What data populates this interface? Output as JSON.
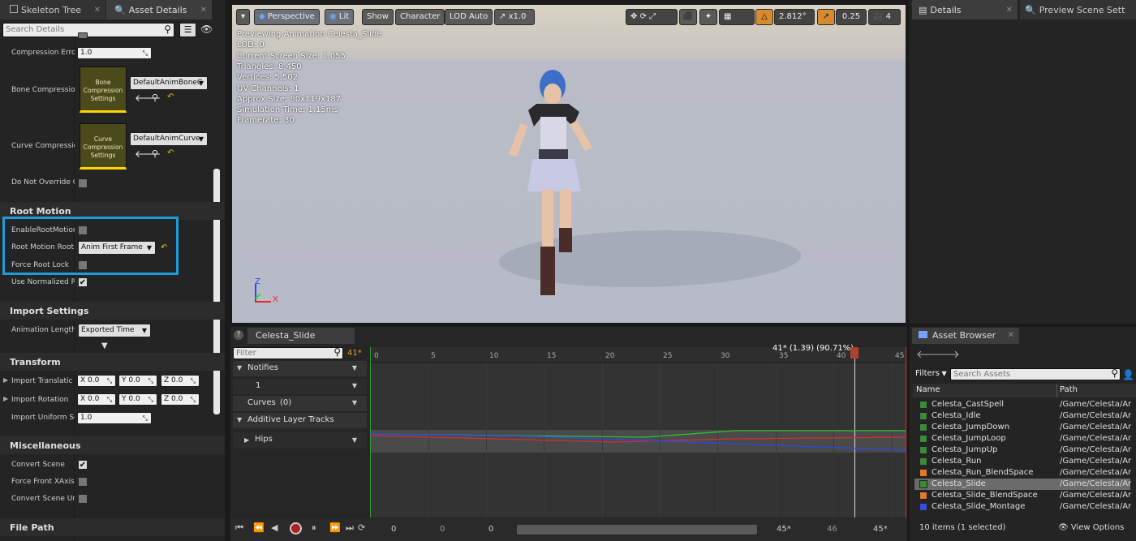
{
  "left_panel": {
    "tabs": [
      "Skeleton Tree",
      "Asset Details"
    ],
    "search_placeholder": "Search Details",
    "rows": {
      "compression_error_label": "Compression Erro",
      "compression_error_value": "1.0",
      "bone_compression_label": "Bone Compressio",
      "bone_thumb": "Bone Compression Settings",
      "bone_combo": "DefaultAnimBoneC",
      "curve_compression_label": "Curve Compressio",
      "curve_thumb": "Curve Compression Settings",
      "curve_combo": "DefaultAnimCurve",
      "do_not_override_label": "Do Not Override C",
      "root_motion_cat": "Root Motion",
      "enable_root_motion_label": "EnableRootMotion",
      "root_motion_root_label": "Root Motion Root",
      "root_motion_root_value": "Anim First Frame",
      "force_root_lock_label": "Force Root Lock",
      "use_normalized_label": "Use Normalized R",
      "import_settings_cat": "Import Settings",
      "animation_length_label": "Animation Length",
      "animation_length_value": "Exported Time",
      "transform_cat": "Transform",
      "import_translation_label": "Import Translatic",
      "import_rotation_label": "Import Rotation",
      "import_uniform_label": "Import Uniform Sc",
      "import_uniform_value": "1.0",
      "misc_cat": "Miscellaneous",
      "convert_scene_label": "Convert Scene",
      "force_front_label": "Force Front XAxis",
      "convert_scene_units_label": "Convert Scene Un",
      "file_path_cat": "File Path"
    },
    "vec": {
      "x_label": "X",
      "y_label": "Y",
      "z_label": "Z",
      "value": "0.0"
    }
  },
  "viewport": {
    "perspective": "Perspective",
    "lit": "Lit",
    "show": "Show",
    "character": "Character",
    "lod": "LOD Auto",
    "speed": "x1.0",
    "angle": "2.812°",
    "scale": "0.25",
    "camera_speed": "4",
    "info": [
      "Previewing Animation Celesta_Slide",
      "LOD: 0",
      "Current Screen Size: 1.055",
      "Triangles: 8,450",
      "Vertices: 5,502",
      "UV Channels: 1",
      "Approx Size: 80x119x187",
      "Simulation Time: 1.15ms",
      "Framerate: 30"
    ],
    "axis_z": "Z",
    "axis_x": "X"
  },
  "right_panel": {
    "tabs": [
      "Details",
      "Preview Scene Sett"
    ]
  },
  "timeline": {
    "tab": "Celesta_Slide",
    "filter_placeholder": "Filter",
    "current_frame": "41*",
    "playhead_label": "41* (1.39) (90.71%)",
    "ticks": [
      "0",
      "5",
      "10",
      "15",
      "20",
      "25",
      "30",
      "35",
      "40",
      "45"
    ],
    "tracks": {
      "notifies": "Notifies",
      "notify_track": "1",
      "curves": "Curves",
      "curves_count": "(0)",
      "additive": "Additive Layer Tracks",
      "hips": "Hips"
    },
    "bottom": {
      "v0": "0",
      "v1": "0",
      "v2": "0",
      "end_a": "45*",
      "mid": "46",
      "end_b": "45*"
    }
  },
  "asset_browser": {
    "tab": "Asset Browser",
    "filters": "Filters",
    "search_placeholder": "Search Assets",
    "col_name": "Name",
    "col_path": "Path",
    "items": [
      {
        "name": "Celesta_CastSpell",
        "path": "/Game/Celesta/Ar",
        "kind": "anim"
      },
      {
        "name": "Celesta_Idle",
        "path": "/Game/Celesta/Ar",
        "kind": "anim"
      },
      {
        "name": "Celesta_JumpDown",
        "path": "/Game/Celesta/Ar",
        "kind": "anim"
      },
      {
        "name": "Celesta_JumpLoop",
        "path": "/Game/Celesta/Ar",
        "kind": "anim"
      },
      {
        "name": "Celesta_JumpUp",
        "path": "/Game/Celesta/Ar",
        "kind": "anim"
      },
      {
        "name": "Celesta_Run",
        "path": "/Game/Celesta/Ar",
        "kind": "anim"
      },
      {
        "name": "Celesta_Run_BlendSpace",
        "path": "/Game/Celesta/Ar",
        "kind": "blend"
      },
      {
        "name": "Celesta_Slide",
        "path": "/Game/Celesta/Ar",
        "kind": "anim",
        "selected": true
      },
      {
        "name": "Celesta_Slide_BlendSpace",
        "path": "/Game/Celesta/Ar",
        "kind": "blend"
      },
      {
        "name": "Celesta_Slide_Montage",
        "path": "/Game/Celesta/Ar",
        "kind": "montage"
      }
    ],
    "status": "10 items (1 selected)",
    "view_options": "View Options"
  },
  "colors": {
    "highlight": "#1e9bdc",
    "anim": "#3a8a3a",
    "blend": "#e07a2a",
    "montage": "#3a4ae0"
  }
}
